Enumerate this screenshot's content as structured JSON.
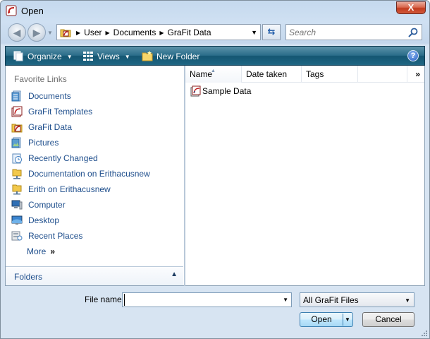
{
  "window": {
    "title": "Open"
  },
  "titlebar": {
    "close_label": "X"
  },
  "nav": {
    "breadcrumb": [
      "User",
      "Documents",
      "GraFit Data"
    ],
    "search_placeholder": "Search"
  },
  "commands": {
    "organize": "Organize",
    "views": "Views",
    "new_folder": "New Folder",
    "help": "?"
  },
  "favorites": {
    "heading": "Favorite Links",
    "items": [
      {
        "label": "Documents",
        "icon": "documents-icon"
      },
      {
        "label": "GraFit Templates",
        "icon": "grafit-templates-icon"
      },
      {
        "label": "GraFit Data",
        "icon": "grafit-data-icon"
      },
      {
        "label": "Pictures",
        "icon": "pictures-icon"
      },
      {
        "label": "Recently Changed",
        "icon": "recently-changed-icon"
      },
      {
        "label": "Documentation on Erithacusnew",
        "icon": "network-folder-icon"
      },
      {
        "label": "Erith on Erithacusnew",
        "icon": "network-folder-icon"
      },
      {
        "label": "Computer",
        "icon": "computer-icon"
      },
      {
        "label": "Desktop",
        "icon": "desktop-icon"
      },
      {
        "label": "Recent Places",
        "icon": "recent-places-icon"
      }
    ],
    "more": "More",
    "more_glyph": "»"
  },
  "folders": {
    "label": "Folders",
    "toggle_glyph": "▲"
  },
  "file_list": {
    "columns": [
      "Name",
      "Date taken",
      "Tags"
    ],
    "more_glyph": "»",
    "items": [
      {
        "name": "Sample Data",
        "icon": "grafit-file-icon"
      }
    ]
  },
  "bottom": {
    "filename_label": "File name:",
    "filename_value": "",
    "filetype": "All GraFit Files",
    "open": "Open",
    "cancel": "Cancel"
  },
  "colors": {
    "command_bar": "#1f6683",
    "link": "#1e4e8c",
    "close_button": "#c13b1f"
  }
}
